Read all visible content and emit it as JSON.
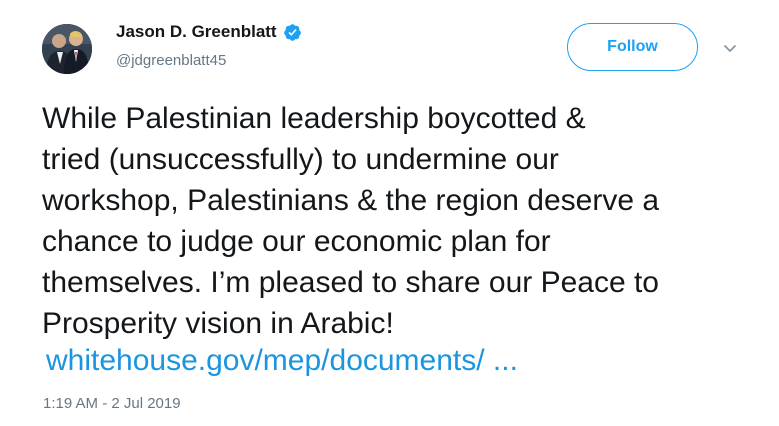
{
  "author": {
    "display_name": "Jason D. Greenblatt",
    "handle": "@jdgreenblatt45",
    "verified_icon": "verified-badge-icon",
    "avatar_icon": "avatar-photo"
  },
  "actions": {
    "follow_label": "Follow",
    "menu_icon": "chevron-down-icon"
  },
  "tweet": {
    "lines": [
      "While Palestinian leadership boycotted &",
      "tried (unsuccessfully) to undermine our",
      "workshop, Palestinians & the region deserve a",
      "chance to judge our economic plan for",
      "themselves. I’m pleased to share our Peace to",
      "Prosperity vision in Arabic!"
    ],
    "link_text": "whitehouse.gov/mep/documents/ ...",
    "timestamp": "1:19 AM - 2 Jul 2019"
  },
  "colors": {
    "brand_blue": "#1da1f2",
    "link_blue": "#1b95e0",
    "text": "#14171a",
    "muted": "#657786"
  }
}
